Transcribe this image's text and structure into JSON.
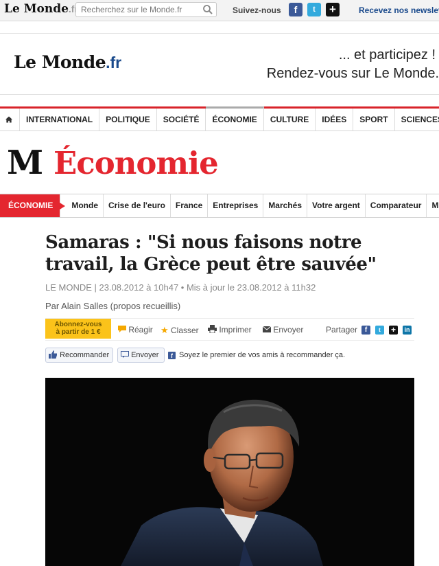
{
  "top": {
    "logo_main": "Le Monde",
    "logo_suffix": ".fr",
    "search_placeholder": "Recherchez sur le Monde.fr",
    "follow_label": "Suivez-nous",
    "newsletter_label": "Recevez nos newsletters"
  },
  "banner": {
    "logo_main": "Le Monde",
    "logo_suffix": ".fr",
    "line1": "... et participez !",
    "line2": "Rendez-vous sur Le Monde."
  },
  "main_nav": [
    "INTERNATIONAL",
    "POLITIQUE",
    "SOCIÉTÉ",
    "ÉCONOMIE",
    "CULTURE",
    "IDÉES",
    "SPORT",
    "SCIENCES"
  ],
  "section": {
    "mark": "M",
    "title": "Économie"
  },
  "sub_nav": {
    "active": "ÉCONOMIE",
    "items": [
      "Monde",
      "Crise de l'euro",
      "France",
      "Entreprises",
      "Marchés",
      "Votre argent",
      "Comparateur",
      "M"
    ]
  },
  "article": {
    "headline": "Samaras : \"Si nous faisons notre travail, la Grèce peut être sauvée\"",
    "meta": "LE MONDE | 23.08.2012 à 10h47 • Mis à jour le 23.08.2012 à 11h32",
    "byline": "Par Alain Salles (propos recueillis)"
  },
  "toolbar": {
    "subscribe_line1": "Abonnez-vous",
    "subscribe_line2": "à partir de 1 €",
    "reagir": "Réagir",
    "classer": "Classer",
    "imprimer": "Imprimer",
    "envoyer": "Envoyer",
    "partager": "Partager"
  },
  "social_row": {
    "recommend": "Recommander",
    "envoyer": "Envoyer",
    "note": "Soyez le premier de vos amis à recommander ça."
  }
}
